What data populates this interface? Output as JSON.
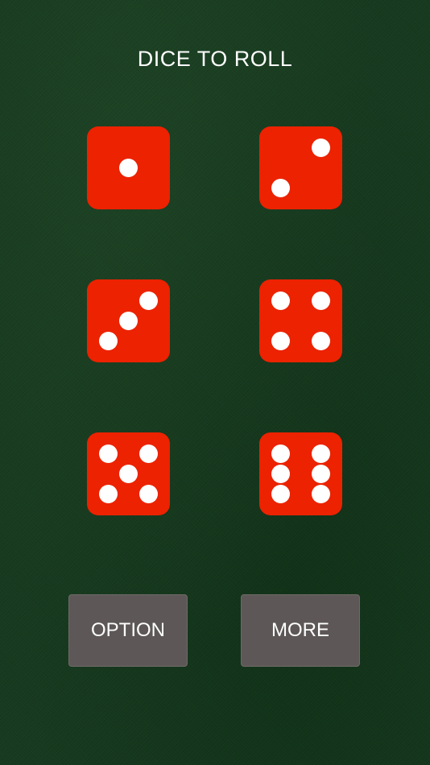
{
  "header": {
    "title": "DICE TO ROLL"
  },
  "dice": [
    {
      "value": 1,
      "color": "#ec2200"
    },
    {
      "value": 2,
      "color": "#ec2200"
    },
    {
      "value": 3,
      "color": "#ec2200"
    },
    {
      "value": 4,
      "color": "#ec2200"
    },
    {
      "value": 5,
      "color": "#ec2200"
    },
    {
      "value": 6,
      "color": "#ec2200"
    }
  ],
  "buttons": {
    "option_label": "OPTION",
    "more_label": "MORE"
  },
  "colors": {
    "felt": "#173a1f",
    "pip": "#ffffff",
    "button": "#5d5857"
  }
}
